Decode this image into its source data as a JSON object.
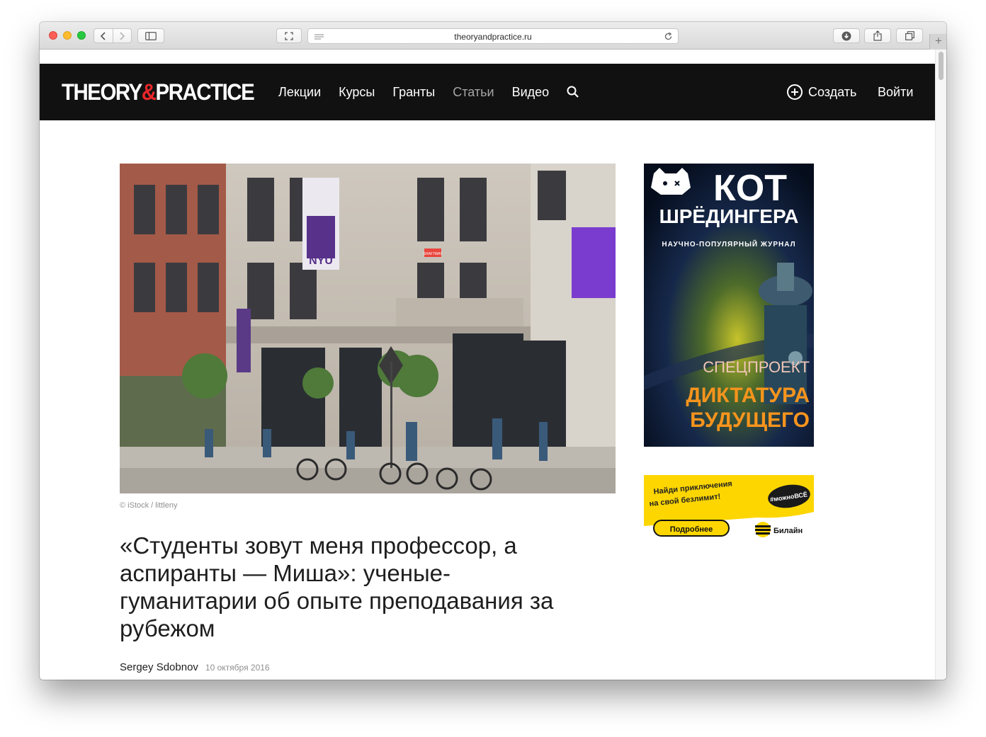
{
  "browser": {
    "url": "theoryandpractice.ru",
    "new_tab": "+"
  },
  "site": {
    "logo_left": "THEORY",
    "logo_amp": "&",
    "logo_right": "PRACTICE",
    "nav": [
      "Лекции",
      "Курсы",
      "Гранты",
      "Статьи",
      "Видео"
    ],
    "create_label": "Создать",
    "login_label": "Войти"
  },
  "article": {
    "hero_flag": "NYU",
    "hero_sign": "SHAFTWAY",
    "caption": "© iStock / littleny",
    "title": "«Студенты зовут меня профессор, а аспиранты — Миша»: ученые-гуманитарии об опыте преподавания за рубежом",
    "author": "Sergey Sdobnov",
    "date": "10 октября 2016"
  },
  "ads": {
    "kot_title": "КОТ",
    "kot_subtitle": "ШРЁДИНГЕРА",
    "kot_tagline": "НАУЧНО-ПОПУЛЯРНЫЙ ЖУРНАЛ",
    "kot_special": "СПЕЦПРОЕКТ",
    "kot_project_1": "ДИКТАТУРА",
    "kot_project_2": "БУДУЩЕГО",
    "beeline_line1": "Найди приключения",
    "beeline_line2": "на свой безлимит!",
    "beeline_hashtag": "#можноВСЁ",
    "beeline_button": "Подробнее",
    "beeline_brand": "Билайн"
  },
  "colors": {
    "header_bg": "#111111",
    "logo_amp": "#e8262a",
    "nav_active": "#a5a5a5",
    "ad_orange": "#f7941d",
    "ad_yellow": "#fdd600"
  }
}
